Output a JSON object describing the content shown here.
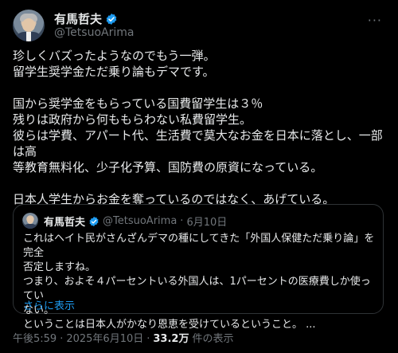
{
  "author": {
    "display_name": "有馬哲夫",
    "handle": "@TetsuoArima"
  },
  "more_icon": "more-dots-icon",
  "tweet": {
    "lines": [
      "珍しくバズったようなのでもう一弾。",
      "留学生奨学金ただ乗り論もデマです。",
      "",
      "国から奨学金をもらっている国費留学生は３％",
      "残りは政府から何ももらわない私費留学生。",
      "彼らは学費、アパート代、生活費で莫大なお金を日本に落とし、一部は高",
      "等教育無料化、少子化予算、国防費の原資になっている。",
      "",
      "日本人学生からお金を奪っているのではなく、あげている。"
    ]
  },
  "quote": {
    "display_name": "有馬哲夫",
    "handle": "@TetsuoArima",
    "separator": "·",
    "date": "6月10日",
    "lines": [
      "これはヘイト民がさんざんデマの種にしてきた「外国人保健ただ乗り論」を完全",
      "否定しますね。",
      "つまり、およそ４パーセントいる外国人は、1パーセントの医療費しか使ってい",
      "ない。",
      "ということは日本人がかなり恩恵を受けているということ。 ..."
    ],
    "show_more": "さらに表示"
  },
  "footer": {
    "time": "午後5:59",
    "separator": "·",
    "date": "2025年6月10日",
    "separator2": "·",
    "views_count": "33.2万",
    "views_label": "件の表示"
  },
  "colors": {
    "background": "#000000",
    "text": "#e7e9ea",
    "muted": "#71767b",
    "link": "#1d9bf0",
    "verified": "#1d9bf0"
  }
}
